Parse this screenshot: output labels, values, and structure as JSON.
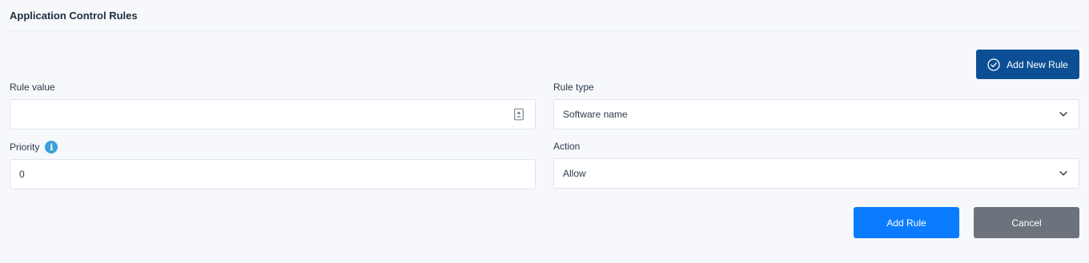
{
  "page": {
    "title": "Application Control Rules"
  },
  "header_actions": {
    "add_new_rule_label": "Add New Rule"
  },
  "form": {
    "rule_value": {
      "label": "Rule value",
      "value": "",
      "placeholder": ""
    },
    "rule_type": {
      "label": "Rule type",
      "selected": "Software name"
    },
    "priority": {
      "label": "Priority",
      "value": "0",
      "info_icon": "info-icon"
    },
    "action": {
      "label": "Action",
      "selected": "Allow"
    }
  },
  "footer": {
    "add_rule_label": "Add Rule",
    "cancel_label": "Cancel"
  },
  "colors": {
    "background": "#f7f8fc",
    "primary_dark": "#0d4f95",
    "primary": "#0b7cff",
    "secondary": "#6c737d",
    "info": "#3aa0d8"
  }
}
